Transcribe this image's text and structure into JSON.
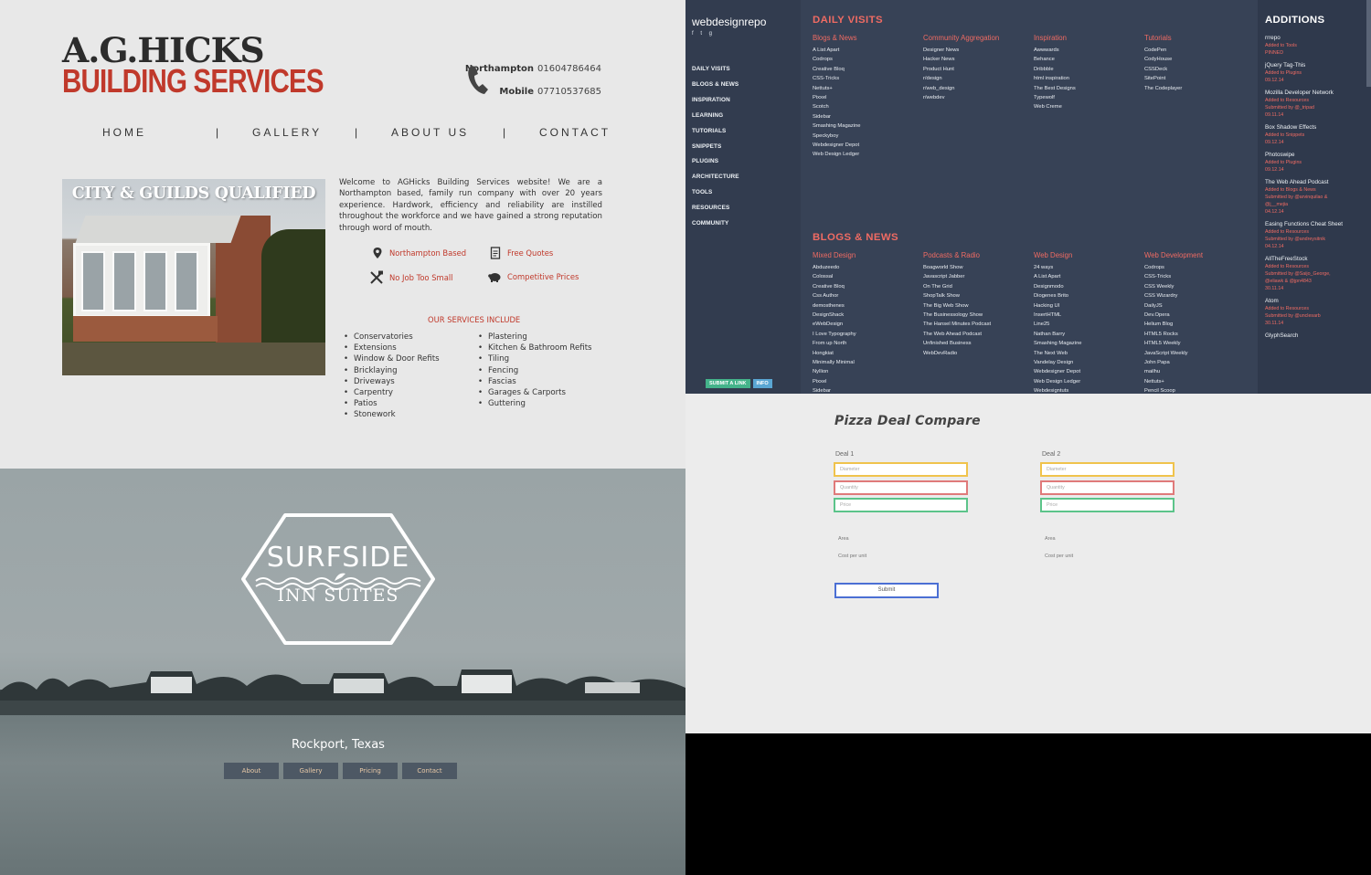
{
  "agh": {
    "logo_line1": "A.G.HICKS",
    "logo_line2": "BUILDING SERVICES",
    "phone": {
      "label1": "Northampton",
      "number1": "01604786464",
      "label2": "Mobile",
      "number2": "07710537685"
    },
    "nav": [
      "HOME",
      "|",
      "GALLERY",
      "|",
      "ABOUT US",
      "|",
      "CONTACT"
    ],
    "hero_title": "CITY & GUILDS QUALIFIED",
    "intro": "Welcome to AGHicks Building Services website! We are a Northampton based, family run company with over 20 years experience. Hardwork, efficiency and reliability are instilled throughout the workforce and we have gained a strong reputation through word of mouth.",
    "features": [
      {
        "icon": "map-pin-icon",
        "label": "Northampton Based"
      },
      {
        "icon": "document-icon",
        "label": "Free Quotes"
      },
      {
        "icon": "tools-icon",
        "label": "No Job Too Small"
      },
      {
        "icon": "piggy-bank-icon",
        "label": "Competitive Prices"
      }
    ],
    "services_heading": "OUR SERVICES INCLUDE",
    "services_left": [
      "Conservatories",
      "Extensions",
      "Window & Door Refits",
      "Bricklaying",
      "Driveways",
      "Carpentry",
      "Patios",
      "Stonework"
    ],
    "services_right": [
      "Plastering",
      "Kitchen & Bathroom Refits",
      "Tiling",
      "Fencing",
      "Fascias",
      "Garages & Carports",
      "Guttering"
    ],
    "accent": "#c0392b"
  },
  "wdr": {
    "brand": "webdesignrepo",
    "social": "f  t  g",
    "nav": [
      "DAILY VISITS",
      "BLOGS & NEWS",
      "INSPIRATION",
      "LEARNING",
      "TUTORIALS",
      "SNIPPETS",
      "PLUGINS",
      "ARCHITECTURE",
      "TOOLS",
      "RESOURCES",
      "COMMUNITY"
    ],
    "submit_label": "SUBMIT A LINK",
    "info_label": "INFO",
    "section1": "DAILY VISITS",
    "daily_cols": [
      {
        "title": "Blogs & News",
        "items": [
          "A List Apart",
          "Codrops",
          "Creative Bloq",
          "CSS-Tricks",
          "Nettuts+",
          "Pixxel",
          "Scotch",
          "Sidebar",
          "Smashing Magazine",
          "Speckyboy",
          "Webdesigner Depot",
          "Web Design Ledger"
        ]
      },
      {
        "title": "Community Aggregation",
        "items": [
          "Designer News",
          "Hacker News",
          "Product Hunt",
          "r/design",
          "r/web_design",
          "r/webdev"
        ]
      },
      {
        "title": "Inspiration",
        "items": [
          "Awwwards",
          "Behance",
          "Dribbble",
          "html inspiration",
          "The Best Designs",
          "Typewolf",
          "Web Creme"
        ]
      },
      {
        "title": "Tutorials",
        "items": [
          "CodePen",
          "CodyHouse",
          "CSSDeck",
          "SitePoint",
          "The Codeplayer"
        ]
      }
    ],
    "section2": "BLOGS & NEWS",
    "blog_cols": [
      {
        "title": "Mixed Design",
        "items": [
          "Abduzeedo",
          "Colossal",
          "Creative Bloq",
          "Css Author",
          "demosthenes",
          "DesignShack",
          "eWebDesign",
          "I Love Typography",
          "From up North",
          "Hongkiat",
          "Minimally Minimal",
          "Nyllion",
          "Pixxel",
          "Sidebar"
        ]
      },
      {
        "title": "Podcasts & Radio",
        "items": [
          "Boagworld Show",
          "Javascript Jabber",
          "On The Grid",
          "ShopTalk Show",
          "The Big Web Show",
          "The Businessology Show",
          "The Hansel Minutes Podcast",
          "The Web Ahead Podcast",
          "Unfinished Business",
          "WebDevRadio"
        ]
      },
      {
        "title": "Web Design",
        "items": [
          "24 ways",
          "A List Apart",
          "Designmodo",
          "Diogenes Brito",
          "Hacking UI",
          "InsertHTML",
          "Line25",
          "Nathan Barry",
          "Smashing Magazine",
          "The Next Web",
          "Vandelay Design",
          "Webdesigner Depot",
          "Web Design Ledger",
          "Webdesigntuts"
        ]
      },
      {
        "title": "Web Development",
        "items": [
          "Codrops",
          "CSS-Tricks",
          "CSS Weekly",
          "CSS Wizardry",
          "DailyJS",
          "Dev.Opera",
          "Helium Blog",
          "HTML5 Rocks",
          "HTML5 Weekly",
          "JavaScript Weekly",
          "John Papa",
          "mailhu",
          "Nettuts+",
          "Pencil Scoop"
        ]
      }
    ],
    "additions_title": "ADDITIONS",
    "additions": [
      {
        "title": "rrrepo",
        "sub": [
          "Added to Tools",
          "PINNED"
        ]
      },
      {
        "title": "jQuery Tag-This",
        "sub": [
          "Added to Plugins",
          "09.12.14"
        ]
      },
      {
        "title": "Mozilla Developer Network",
        "sub": [
          "Added to Resources",
          "Submitted by @_tripad",
          "09.11.14"
        ]
      },
      {
        "title": "Box Shadow Effects",
        "sub": [
          "Added to Snippets",
          "09.12.14"
        ]
      },
      {
        "title": "Photoswipe",
        "sub": [
          "Added to Plugins",
          "09.12.14"
        ]
      },
      {
        "title": "The Web Ahead Podcast",
        "sub": [
          "Added to Blogs & News",
          "Submitted by @arvinquilao &",
          "@j__mejia",
          "04.12.14"
        ]
      },
      {
        "title": "Easing Functions Cheat Sheet",
        "sub": [
          "Added to Resources",
          "Submitted by @andreysitnik",
          "04.12.14"
        ]
      },
      {
        "title": "AllTheFreeStock",
        "sub": [
          "Added to Resources",
          "Submitted by @Saijo_George,",
          "@eliawk & @jpn4843",
          "30.11.14"
        ]
      },
      {
        "title": "Atom",
        "sub": [
          "Added to Resources",
          "Submitted by @unclesarb",
          "30.11.14"
        ]
      },
      {
        "title": "GlyphSearch",
        "sub": []
      }
    ],
    "accent": "#ef6b63",
    "bg": "#374256"
  },
  "surf": {
    "badge_line1": "SURFSIDE",
    "badge_line2": "INN SUITES",
    "location": "Rockport, Texas",
    "nav": [
      "About",
      "Gallery",
      "Pricing",
      "Contact"
    ]
  },
  "pizza": {
    "title": "Pizza Deal Compare",
    "deal1_label": "Deal 1",
    "deal2_label": "Deal 2",
    "placeholders": {
      "diameter": "Diameter",
      "quantity": "Quantity",
      "price": "Price"
    },
    "area_label": "Area",
    "cost_label": "Cost per unit",
    "submit_label": "Submit"
  }
}
